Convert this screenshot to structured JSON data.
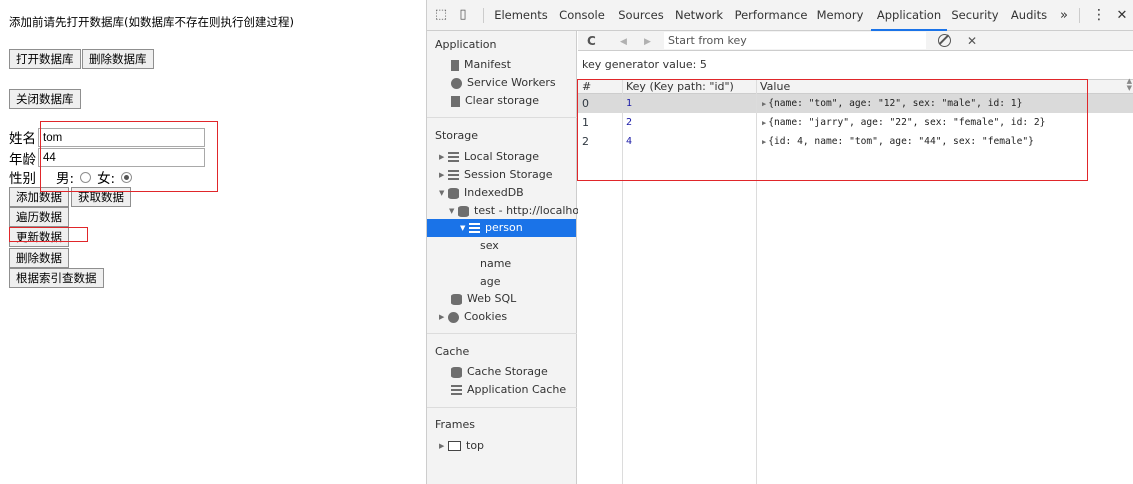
{
  "page": {
    "note": "添加前请先打开数据库(如数据库不存在则执行创建过程)",
    "buttons": {
      "open_db": "打开数据库",
      "delete_db": "删除数据库",
      "close_db": "关闭数据库",
      "add_data": "添加数据",
      "get_data": "获取数据",
      "iterate_data": "遍历数据",
      "update_data": "更新数据",
      "delete_data": "删除数据",
      "query_by_index": "根据索引查数据"
    },
    "form": {
      "name_label": "姓名",
      "name_value": "tom",
      "age_label": "年龄",
      "age_value": "44",
      "sex_label": "性别",
      "male_label": "男:",
      "female_label": "女:",
      "selected_sex": "female"
    }
  },
  "devtools": {
    "tabs": [
      "Elements",
      "Console",
      "Sources",
      "Network",
      "Performance",
      "Memory",
      "Application",
      "Security",
      "Audits"
    ],
    "active_tab": "Application",
    "more_tabs_glyph": "»",
    "menu_glyph": "⋮",
    "close_glyph": "✕",
    "sidebar": {
      "application_header": "Application",
      "application_items": [
        "Manifest",
        "Service Workers",
        "Clear storage"
      ],
      "storage_header": "Storage",
      "local_storage": "Local Storage",
      "session_storage": "Session Storage",
      "indexeddb": "IndexedDB",
      "db_entry": "test - http://localhost",
      "store": "person",
      "indexes": [
        "sex",
        "name",
        "age"
      ],
      "web_sql": "Web SQL",
      "cookies": "Cookies",
      "cache_header": "Cache",
      "cache_items": [
        "Cache Storage",
        "Application Cache"
      ],
      "frames_header": "Frames",
      "frames_top": "top"
    },
    "toolbar": {
      "refresh_glyph": "C",
      "prev_glyph": "◀",
      "next_glyph": "▶",
      "start_key_placeholder": "Start from key",
      "clear_glyph": "⃠",
      "delete_glyph": "✕"
    },
    "key_generator": "key generator value: 5",
    "table": {
      "headers": [
        "#",
        "Key (Key path: \"id\")",
        "Value"
      ],
      "rows": [
        {
          "index": "0",
          "key": "1",
          "value": "{name: \"tom\", age: \"12\", sex: \"male\", id: 1}"
        },
        {
          "index": "1",
          "key": "2",
          "value": "{name: \"jarry\", age: \"22\", sex: \"female\", id: 2}"
        },
        {
          "index": "2",
          "key": "4",
          "value": "{id: 4, name: \"tom\", age: \"44\", sex: \"female\"}"
        }
      ]
    }
  },
  "colors": {
    "highlight_red": "#e0262a",
    "selection_blue": "#1a73e8",
    "key_blue": "#1a1aa6"
  }
}
